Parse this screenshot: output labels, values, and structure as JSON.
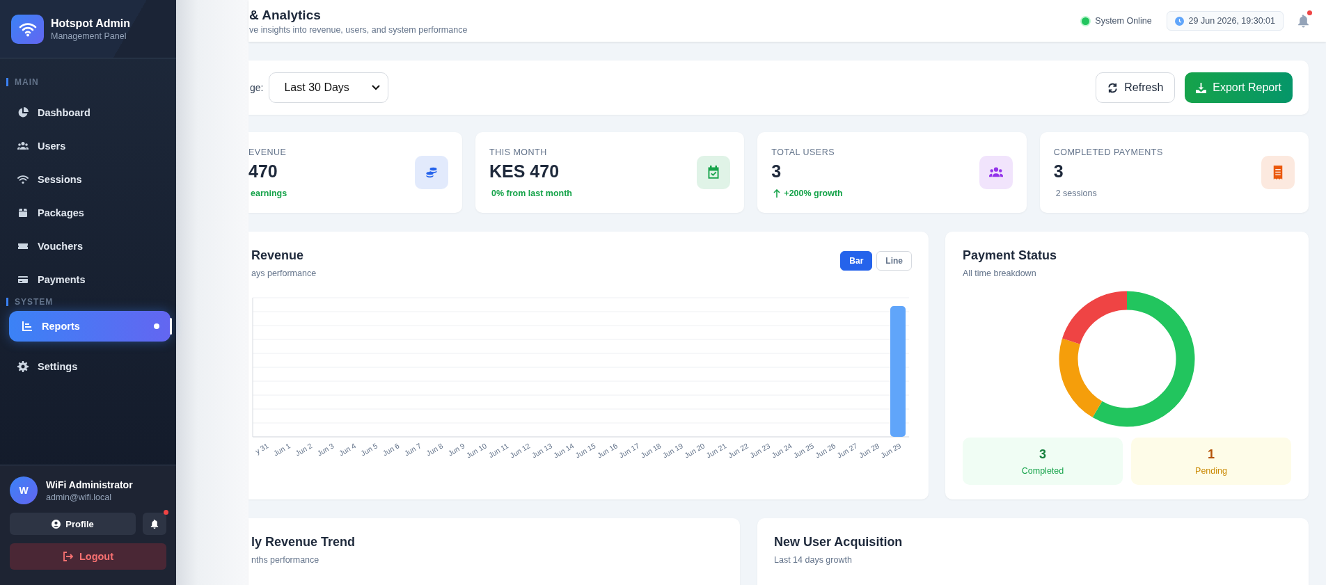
{
  "sidebar": {
    "brand": {
      "title": "Hotspot Admin",
      "subtitle": "Management Panel"
    },
    "sections": [
      {
        "heading": "MAIN",
        "items": [
          {
            "label": "Dashboard",
            "selected": false
          },
          {
            "label": "Users",
            "selected": false
          },
          {
            "label": "Sessions",
            "selected": false
          },
          {
            "label": "Packages",
            "selected": false
          },
          {
            "label": "Vouchers",
            "selected": false
          },
          {
            "label": "Payments",
            "selected": false
          }
        ]
      },
      {
        "heading": "SYSTEM",
        "items": [
          {
            "label": "Reports",
            "selected": true
          },
          {
            "label": "Settings",
            "selected": false
          }
        ]
      }
    ],
    "user": {
      "initial": "W",
      "name": "WiFi Administrator",
      "email": "admin@wifi.local"
    },
    "profile_button": "Profile",
    "notification_unread": true,
    "logout_button": "Logout"
  },
  "header": {
    "title": "& Analytics",
    "subtitle": "ve insights into revenue, users, and system performance",
    "status": {
      "label": "System Online",
      "online": true
    },
    "datetime": "29 Jun 2026, 19:30:01",
    "notification_unread": true
  },
  "toolbar": {
    "range_label": "ge:",
    "range_value": "Last 30 Days",
    "buttons": [
      {
        "label": "Refresh",
        "kind": "secondary"
      },
      {
        "label": "Export Report",
        "kind": "primary"
      }
    ]
  },
  "stats": [
    {
      "label": "EVENUE",
      "value": "470",
      "note": "earnings",
      "color": "#2563eb"
    },
    {
      "label": "THIS MONTH",
      "value": "KES 470",
      "note": "0% from last month",
      "color": "#16a34a"
    },
    {
      "label": "TOTAL USERS",
      "value": "3",
      "note": "+200% growth",
      "color": "#9333ea"
    },
    {
      "label": "COMPLETED PAYMENTS",
      "value": "3",
      "note": "2 sessions",
      "color": "#ea580c"
    }
  ],
  "revenue_chart": {
    "title": "Revenue",
    "subtitle": "ays performance",
    "toggles": [
      {
        "label": "Bar",
        "selected": true
      },
      {
        "label": "Line",
        "selected": false
      }
    ],
    "x_labels": [
      "y 31",
      "Jun 1",
      "Jun 2",
      "Jun 3",
      "Jun 4",
      "Jun 5",
      "Jun 6",
      "Jun 7",
      "Jun 8",
      "Jun 9",
      "Jun 10",
      "Jun 11",
      "Jun 12",
      "Jun 13",
      "Jun 14",
      "Jun 15",
      "Jun 16",
      "Jun 17",
      "Jun 18",
      "Jun 19",
      "Jun 20",
      "Jun 21",
      "Jun 22",
      "Jun 23",
      "Jun 24",
      "Jun 25",
      "Jun 26",
      "Jun 27",
      "Jun 28",
      "Jun 29"
    ]
  },
  "payment_status": {
    "title": "Payment Status",
    "subtitle": "All time breakdown",
    "summary": [
      {
        "value": "3",
        "label": "Completed",
        "kind": "completed"
      },
      {
        "value": "1",
        "label": "Pending",
        "kind": "pending"
      }
    ]
  },
  "bottom_cards": [
    {
      "title": "ly Revenue Trend",
      "subtitle": "nths performance"
    },
    {
      "title": "New User Acquisition",
      "subtitle": "Last 14 days growth"
    }
  ]
}
